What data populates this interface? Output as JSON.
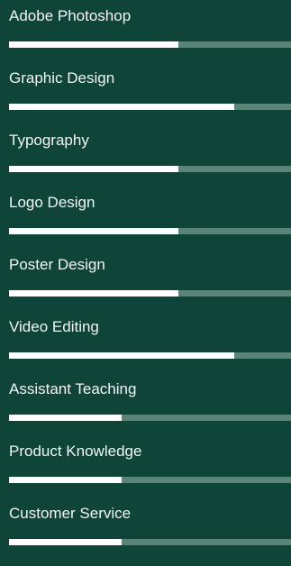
{
  "skills": [
    {
      "label": "Adobe Photoshop",
      "level": 0.6
    },
    {
      "label": "Graphic Design",
      "level": 0.8
    },
    {
      "label": "Typography",
      "level": 0.6
    },
    {
      "label": "Logo Design",
      "level": 0.6
    },
    {
      "label": "Poster Design",
      "level": 0.6
    },
    {
      "label": "Video Editing",
      "level": 0.8
    },
    {
      "label": "Assistant Teaching",
      "level": 0.4
    },
    {
      "label": "Product Knowledge",
      "level": 0.4
    },
    {
      "label": "Customer Service",
      "level": 0.4
    }
  ],
  "colors": {
    "background": "#0f4538",
    "track": "#5b8478",
    "fill": "#ffffff",
    "text": "#f2f5f4"
  }
}
